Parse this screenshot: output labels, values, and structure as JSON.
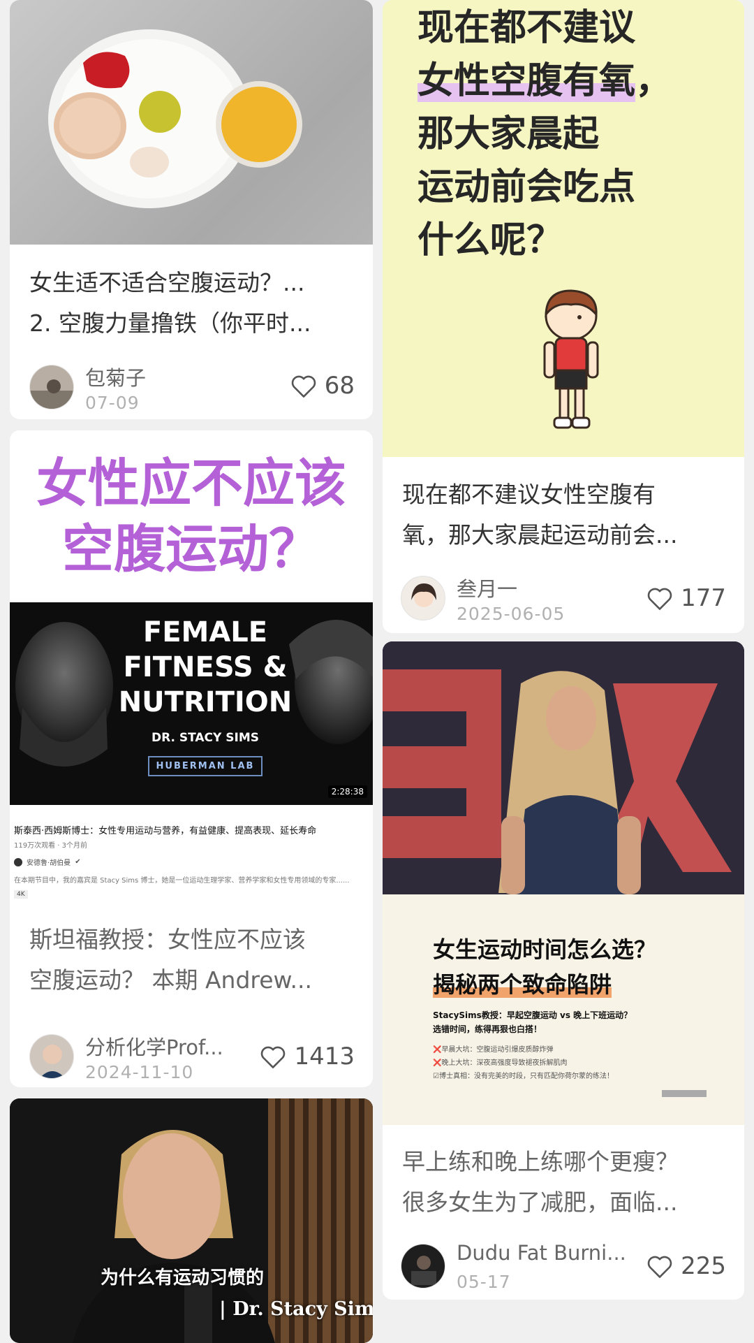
{
  "feed": {
    "cards": [
      {
        "id": "food",
        "title_lines": [
          "女生适不适合空腹运动？...",
          "2. 空腹力量撸铁（你平时..."
        ],
        "author": "包菊子",
        "date": "07-09",
        "likes": "68"
      },
      {
        "id": "yellow",
        "cover_text": {
          "line1": "现在都不建议",
          "line2_highlight": "女性空腹有氧",
          "line2_tail": "，",
          "line3": "那大家晨起",
          "line4": "运动前会吃点",
          "line5": "什么呢？"
        },
        "title_lines": [
          "现在都不建议女性空腹有",
          "氧，那大家晨起运动前会..."
        ],
        "author": "叁月一",
        "date": "2025-06-05",
        "likes": "177"
      },
      {
        "id": "huberman",
        "cover_heading_lines": [
          "女性应不应该",
          "空腹运动？"
        ],
        "video": {
          "headline_lines": [
            "FEMALE",
            "FITNESS &",
            "NUTRITION"
          ],
          "subtitle": "DR. STACY SIMS",
          "channel_badge": "HUBERMAN LAB",
          "duration": "2:28:38"
        },
        "meta": {
          "video_title": "斯泰西·西姆斯博士：女性专用运动与营养，有益健康、提高表现、延长寿命",
          "views": "119万次观看 · 3个月前",
          "channel": "安德鲁·胡伯曼",
          "description": "在本期节目中，我的嘉宾是 Stacy Sims 博士，她是一位运动生理学家、营养学家和女性专用领域的专家......",
          "quality": "4K"
        },
        "title_lines": [
          "斯坦福教授：女性应不应该",
          "空腹运动？ 本期 Andrew..."
        ],
        "author": "分析化学Prof...",
        "date": "2024-11-10",
        "likes": "1413"
      },
      {
        "id": "ted",
        "cover_caption": {
          "title_line1": "女生运动时间怎么选？",
          "title_line2": "揭秘两个致命陷阱",
          "sub1": "StacySims教授：早起空腹运动 vs 晚上下班运动？",
          "sub2": "选错时间，练得再狠也白搭！",
          "bullet1": "❌早晨大坑：空腹运动引爆皮质醇炸弹",
          "bullet2": "❌晚上大坑：深夜高强度导致褪夜拆解肌肉",
          "bullet3": "☑博士真相：没有完美的时段，只有匹配你荷尔蒙的练法！"
        },
        "title_lines": [
          "早上练和晚上练哪个更瘦？",
          "很多女生为了减肥，面临..."
        ],
        "author": "Dudu Fat Burni...",
        "date": "05-17",
        "likes": "225"
      },
      {
        "id": "interview",
        "subtitle_cn": "为什么有运动习惯的",
        "subtitle_en": "| Dr. Stacy Sims"
      }
    ]
  },
  "colors": {
    "accent_purple": "#b461d8",
    "cover_yellow": "#f6f6c2",
    "highlight_lilac": "#e6c2f0",
    "text_muted": "#666666"
  },
  "icons": [
    "heart-icon",
    "verified-icon"
  ]
}
